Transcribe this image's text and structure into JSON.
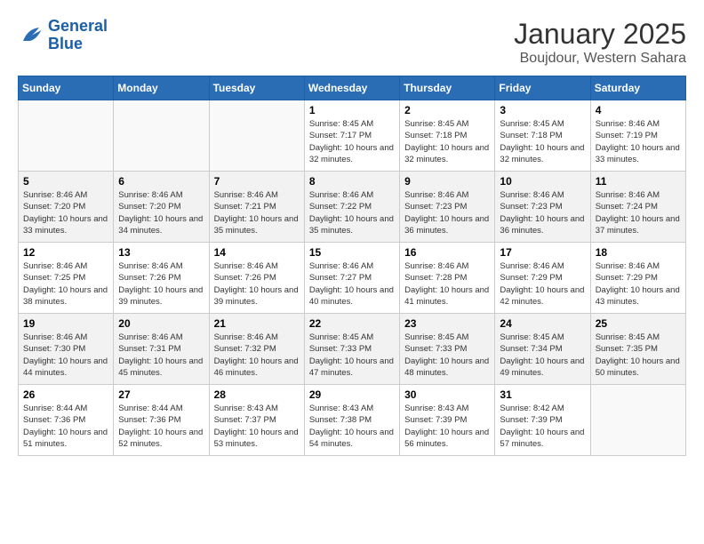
{
  "logo": {
    "line1": "General",
    "line2": "Blue"
  },
  "title": "January 2025",
  "location": "Boujdour, Western Sahara",
  "days_of_week": [
    "Sunday",
    "Monday",
    "Tuesday",
    "Wednesday",
    "Thursday",
    "Friday",
    "Saturday"
  ],
  "weeks": [
    [
      {
        "date": "",
        "sunrise": "",
        "sunset": "",
        "daylight": ""
      },
      {
        "date": "",
        "sunrise": "",
        "sunset": "",
        "daylight": ""
      },
      {
        "date": "",
        "sunrise": "",
        "sunset": "",
        "daylight": ""
      },
      {
        "date": "1",
        "sunrise": "Sunrise: 8:45 AM",
        "sunset": "Sunset: 7:17 PM",
        "daylight": "Daylight: 10 hours and 32 minutes."
      },
      {
        "date": "2",
        "sunrise": "Sunrise: 8:45 AM",
        "sunset": "Sunset: 7:18 PM",
        "daylight": "Daylight: 10 hours and 32 minutes."
      },
      {
        "date": "3",
        "sunrise": "Sunrise: 8:45 AM",
        "sunset": "Sunset: 7:18 PM",
        "daylight": "Daylight: 10 hours and 32 minutes."
      },
      {
        "date": "4",
        "sunrise": "Sunrise: 8:46 AM",
        "sunset": "Sunset: 7:19 PM",
        "daylight": "Daylight: 10 hours and 33 minutes."
      }
    ],
    [
      {
        "date": "5",
        "sunrise": "Sunrise: 8:46 AM",
        "sunset": "Sunset: 7:20 PM",
        "daylight": "Daylight: 10 hours and 33 minutes."
      },
      {
        "date": "6",
        "sunrise": "Sunrise: 8:46 AM",
        "sunset": "Sunset: 7:20 PM",
        "daylight": "Daylight: 10 hours and 34 minutes."
      },
      {
        "date": "7",
        "sunrise": "Sunrise: 8:46 AM",
        "sunset": "Sunset: 7:21 PM",
        "daylight": "Daylight: 10 hours and 35 minutes."
      },
      {
        "date": "8",
        "sunrise": "Sunrise: 8:46 AM",
        "sunset": "Sunset: 7:22 PM",
        "daylight": "Daylight: 10 hours and 35 minutes."
      },
      {
        "date": "9",
        "sunrise": "Sunrise: 8:46 AM",
        "sunset": "Sunset: 7:23 PM",
        "daylight": "Daylight: 10 hours and 36 minutes."
      },
      {
        "date": "10",
        "sunrise": "Sunrise: 8:46 AM",
        "sunset": "Sunset: 7:23 PM",
        "daylight": "Daylight: 10 hours and 36 minutes."
      },
      {
        "date": "11",
        "sunrise": "Sunrise: 8:46 AM",
        "sunset": "Sunset: 7:24 PM",
        "daylight": "Daylight: 10 hours and 37 minutes."
      }
    ],
    [
      {
        "date": "12",
        "sunrise": "Sunrise: 8:46 AM",
        "sunset": "Sunset: 7:25 PM",
        "daylight": "Daylight: 10 hours and 38 minutes."
      },
      {
        "date": "13",
        "sunrise": "Sunrise: 8:46 AM",
        "sunset": "Sunset: 7:26 PM",
        "daylight": "Daylight: 10 hours and 39 minutes."
      },
      {
        "date": "14",
        "sunrise": "Sunrise: 8:46 AM",
        "sunset": "Sunset: 7:26 PM",
        "daylight": "Daylight: 10 hours and 39 minutes."
      },
      {
        "date": "15",
        "sunrise": "Sunrise: 8:46 AM",
        "sunset": "Sunset: 7:27 PM",
        "daylight": "Daylight: 10 hours and 40 minutes."
      },
      {
        "date": "16",
        "sunrise": "Sunrise: 8:46 AM",
        "sunset": "Sunset: 7:28 PM",
        "daylight": "Daylight: 10 hours and 41 minutes."
      },
      {
        "date": "17",
        "sunrise": "Sunrise: 8:46 AM",
        "sunset": "Sunset: 7:29 PM",
        "daylight": "Daylight: 10 hours and 42 minutes."
      },
      {
        "date": "18",
        "sunrise": "Sunrise: 8:46 AM",
        "sunset": "Sunset: 7:29 PM",
        "daylight": "Daylight: 10 hours and 43 minutes."
      }
    ],
    [
      {
        "date": "19",
        "sunrise": "Sunrise: 8:46 AM",
        "sunset": "Sunset: 7:30 PM",
        "daylight": "Daylight: 10 hours and 44 minutes."
      },
      {
        "date": "20",
        "sunrise": "Sunrise: 8:46 AM",
        "sunset": "Sunset: 7:31 PM",
        "daylight": "Daylight: 10 hours and 45 minutes."
      },
      {
        "date": "21",
        "sunrise": "Sunrise: 8:46 AM",
        "sunset": "Sunset: 7:32 PM",
        "daylight": "Daylight: 10 hours and 46 minutes."
      },
      {
        "date": "22",
        "sunrise": "Sunrise: 8:45 AM",
        "sunset": "Sunset: 7:33 PM",
        "daylight": "Daylight: 10 hours and 47 minutes."
      },
      {
        "date": "23",
        "sunrise": "Sunrise: 8:45 AM",
        "sunset": "Sunset: 7:33 PM",
        "daylight": "Daylight: 10 hours and 48 minutes."
      },
      {
        "date": "24",
        "sunrise": "Sunrise: 8:45 AM",
        "sunset": "Sunset: 7:34 PM",
        "daylight": "Daylight: 10 hours and 49 minutes."
      },
      {
        "date": "25",
        "sunrise": "Sunrise: 8:45 AM",
        "sunset": "Sunset: 7:35 PM",
        "daylight": "Daylight: 10 hours and 50 minutes."
      }
    ],
    [
      {
        "date": "26",
        "sunrise": "Sunrise: 8:44 AM",
        "sunset": "Sunset: 7:36 PM",
        "daylight": "Daylight: 10 hours and 51 minutes."
      },
      {
        "date": "27",
        "sunrise": "Sunrise: 8:44 AM",
        "sunset": "Sunset: 7:36 PM",
        "daylight": "Daylight: 10 hours and 52 minutes."
      },
      {
        "date": "28",
        "sunrise": "Sunrise: 8:43 AM",
        "sunset": "Sunset: 7:37 PM",
        "daylight": "Daylight: 10 hours and 53 minutes."
      },
      {
        "date": "29",
        "sunrise": "Sunrise: 8:43 AM",
        "sunset": "Sunset: 7:38 PM",
        "daylight": "Daylight: 10 hours and 54 minutes."
      },
      {
        "date": "30",
        "sunrise": "Sunrise: 8:43 AM",
        "sunset": "Sunset: 7:39 PM",
        "daylight": "Daylight: 10 hours and 56 minutes."
      },
      {
        "date": "31",
        "sunrise": "Sunrise: 8:42 AM",
        "sunset": "Sunset: 7:39 PM",
        "daylight": "Daylight: 10 hours and 57 minutes."
      },
      {
        "date": "",
        "sunrise": "",
        "sunset": "",
        "daylight": ""
      }
    ]
  ]
}
